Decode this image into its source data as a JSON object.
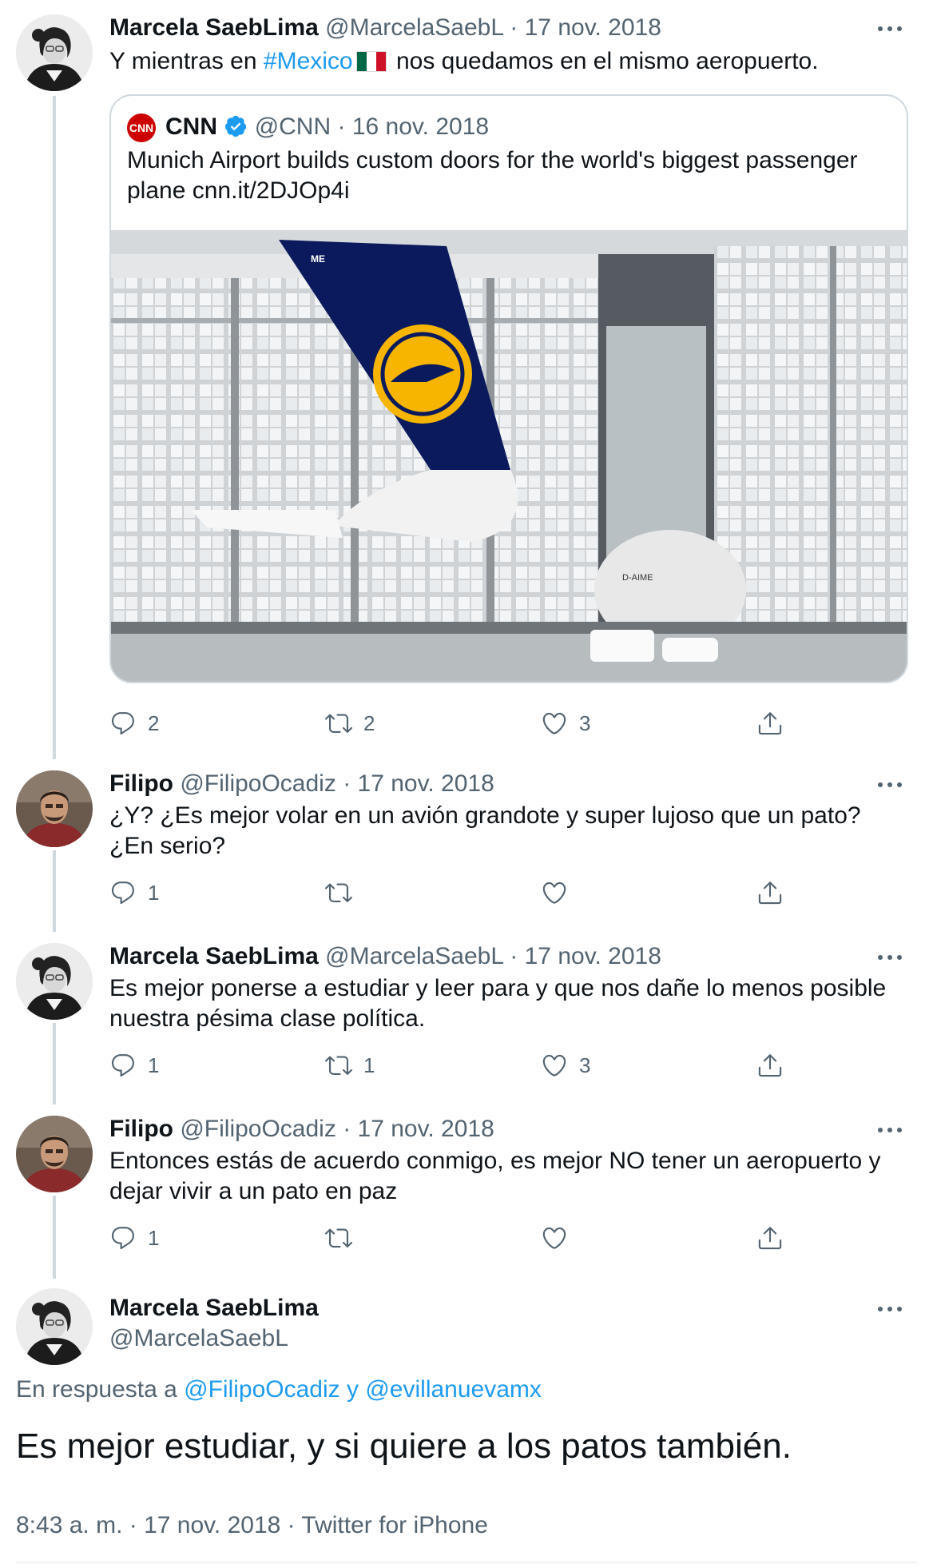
{
  "tweets": [
    {
      "name": "Marcela SaebLima",
      "handle": "@MarcelaSaebL",
      "date": "17 nov. 2018",
      "text_before": "Y mientras en ",
      "hashtag": "#Mexico",
      "text_after": " nos quedamos en el mismo aeropuerto.",
      "replies": "2",
      "retweets": "2",
      "likes": "3"
    },
    {
      "name": "Filipo",
      "handle": "@FilipoOcadiz",
      "date": "17 nov. 2018",
      "text": "¿Y? ¿Es mejor volar en un avión grandote y super lujoso que un pato? ¿En serio?",
      "replies": "1",
      "retweets": "",
      "likes": ""
    },
    {
      "name": "Marcela SaebLima",
      "handle": "@MarcelaSaebL",
      "date": "17 nov. 2018",
      "text": "Es mejor ponerse a estudiar y leer para y que nos dañe lo menos posible nuestra pésima clase política.",
      "replies": "1",
      "retweets": "1",
      "likes": "3"
    },
    {
      "name": "Filipo",
      "handle": "@FilipoOcadiz",
      "date": "17 nov. 2018",
      "text": "Entonces estás de acuerdo conmigo, es mejor NO tener un aeropuerto y dejar vivir a un pato en paz",
      "replies": "1",
      "retweets": "",
      "likes": ""
    }
  ],
  "quoted": {
    "name": "CNN",
    "handle": "@CNN",
    "date": "16 nov. 2018",
    "text": "Munich Airport builds custom doors for the world's biggest passenger plane cnn.it/2DJOp4i",
    "logo_text": "CNN",
    "tail_code": "ME",
    "registration": "D-AIME"
  },
  "main": {
    "name": "Marcela SaebLima",
    "handle": "@MarcelaSaebL",
    "reply_prefix": "En respuesta a",
    "reply_user1": "@FilipoOcadiz",
    "reply_and": "y",
    "reply_user2": "@evillanuevamx",
    "text": "Es mejor estudiar, y si quiere a los patos también.",
    "footer": "8:43 a. m. · 17 nov. 2018 · Twitter for iPhone"
  },
  "separator": "·",
  "colors": {
    "link": "#1d9bf0",
    "secondary": "#536471",
    "border": "#cfd9de",
    "verified": "#1d9bf0"
  },
  "icons": [
    "reply-icon",
    "retweet-icon",
    "like-icon",
    "share-icon",
    "more-icon",
    "verified-badge-icon",
    "mexico-flag-icon"
  ]
}
